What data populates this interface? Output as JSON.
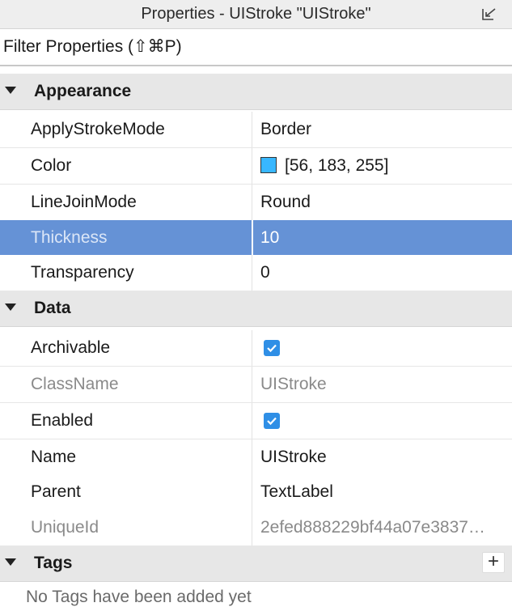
{
  "window": {
    "title": "Properties - UIStroke \"UIStroke\"",
    "undock_icon": "undock-arrow-icon"
  },
  "filter": {
    "placeholder": "Filter Properties (⇧⌘P)",
    "value": ""
  },
  "sections": {
    "appearance": {
      "label": "Appearance",
      "rows": {
        "apply_stroke_mode": {
          "name": "ApplyStrokeMode",
          "value": "Border"
        },
        "color": {
          "name": "Color",
          "value": "[56, 183, 255]",
          "swatch": "#38b7ff"
        },
        "line_join_mode": {
          "name": "LineJoinMode",
          "value": "Round"
        },
        "thickness": {
          "name": "Thickness",
          "value": "10"
        },
        "transparency": {
          "name": "Transparency",
          "value": "0"
        }
      }
    },
    "data": {
      "label": "Data",
      "rows": {
        "archivable": {
          "name": "Archivable",
          "checked": true
        },
        "class_name": {
          "name": "ClassName",
          "value": "UIStroke"
        },
        "enabled": {
          "name": "Enabled",
          "checked": true
        },
        "name": {
          "name": "Name",
          "value": "UIStroke"
        },
        "parent": {
          "name": "Parent",
          "value": "TextLabel"
        },
        "unique_id": {
          "name": "UniqueId",
          "value": "2efed888229bf44a07e3837…"
        }
      }
    },
    "tags": {
      "label": "Tags",
      "add_label": "+",
      "empty_text": "No Tags have been added yet"
    }
  },
  "colors": {
    "selection": "#6592d6",
    "checkbox": "#2f8fe6",
    "section_bg": "#e7e7e7"
  }
}
